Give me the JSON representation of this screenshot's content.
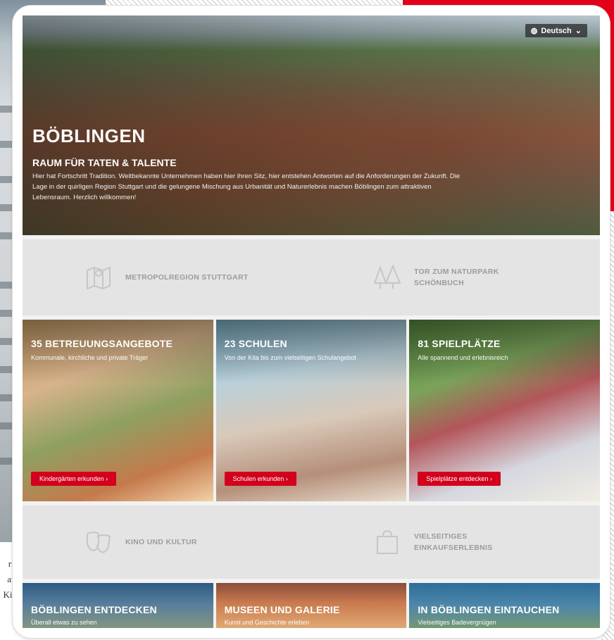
{
  "background": {
    "side_text": [
      "rt-",
      "ar:",
      "Kio"
    ],
    "accent_color": "#e2001a"
  },
  "header": {
    "language_label": "Deutsch",
    "language_icon": "globe-icon",
    "language_caret": "chevron-down-icon"
  },
  "hero": {
    "title": "BÖBLINGEN",
    "subtitle": "RAUM FÜR TATEN & TALENTE",
    "body": "Hier hat Fortschritt Tradition. Weltbekannte Unternehmen haben hier ihren Sitz, hier entstehen Antworten auf die Anforderungen der Zukunft. Die Lage in der quirligen Region Stuttgart und die gelungene Mischung aus Urbanität und Naturerlebnis machen Böblingen zum attraktiven Lebensraum. Herzlich willkommen!"
  },
  "features_top": [
    {
      "label": "METROPOLREGION STUTTGART",
      "icon": "map-icon"
    },
    {
      "label": "TOR ZUM NATURPARK SCHÖNBUCH",
      "icon": "trees-icon"
    }
  ],
  "tiles": [
    {
      "title": "35 BETREUUNGSANGEBOTE",
      "subtitle": "Kommunale, kirchliche und private Träger",
      "button": "Kindergärten erkunden  ›"
    },
    {
      "title": "23 SCHULEN",
      "subtitle": "Von der Kita bis zum vielseitigen Schulangebot",
      "button": "Schulen erkunden  ›"
    },
    {
      "title": "81 SPIELPLÄTZE",
      "subtitle": "Alle spannend und erlebnisreich",
      "button": "Spielplätze entdecken  ›"
    }
  ],
  "features_bottom": [
    {
      "label": "KINO UND KULTUR",
      "icon": "theater-masks-icon"
    },
    {
      "label": "VIELSEITIGES EINKAUFSERLEBNIS",
      "icon": "shopping-bag-icon"
    }
  ],
  "bottom_tiles": [
    {
      "title": "BÖBLINGEN ENTDECKEN",
      "subtitle": "Überall etwas zu sehen"
    },
    {
      "title": "MUSEEN UND GALERIE",
      "subtitle": "Kunst und Geschichte erleben"
    },
    {
      "title": "IN BÖBLINGEN EINTAUCHEN",
      "subtitle": "Vielseitiges Badevergnügen"
    }
  ]
}
